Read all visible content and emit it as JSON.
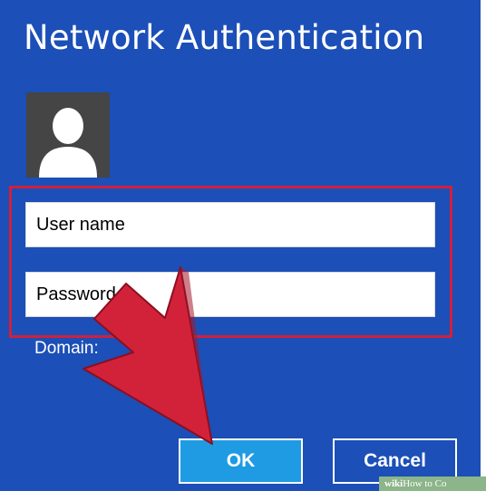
{
  "dialog": {
    "title": "Network Authentication",
    "avatar_icon": "user-silhouette-icon"
  },
  "form": {
    "username_placeholder": "User name",
    "password_placeholder": "Password",
    "domain_label": "Domain:"
  },
  "buttons": {
    "ok_label": "OK",
    "cancel_label": "Cancel"
  },
  "watermark": {
    "brand": "wiki",
    "text": "How to Co"
  },
  "colors": {
    "dialog_background": "#1c4fb7",
    "ok_button": "#1e9be3",
    "highlight_box": "#d21f3c",
    "arrow": "#d2223a"
  }
}
